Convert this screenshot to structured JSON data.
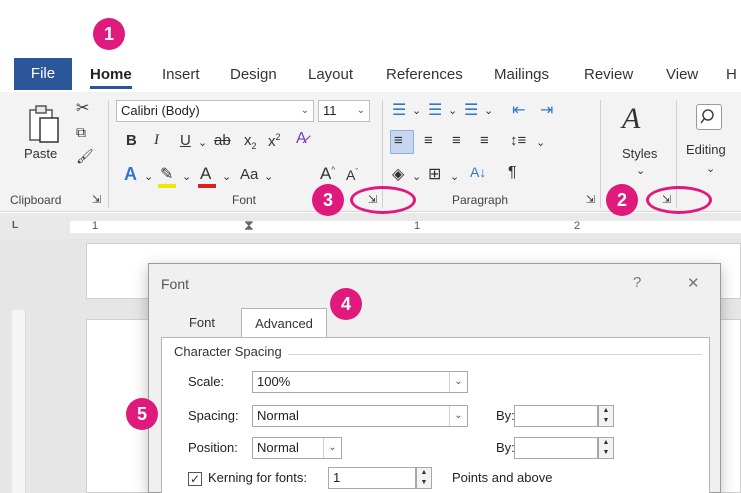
{
  "tabs": [
    "File",
    "Home",
    "Insert",
    "Design",
    "Layout",
    "References",
    "Mailings",
    "Review",
    "View",
    "H"
  ],
  "clipboard": {
    "paste": "Paste",
    "label": "Clipboard"
  },
  "font_group": {
    "font_name": "Calibri (Body)",
    "font_size": "11",
    "bold": "B",
    "italic": "I",
    "underline": "U",
    "strike": "ab",
    "subscript": "x",
    "superscript": "x",
    "change_case": "Aa",
    "grow": "A",
    "shrink": "A",
    "label": "Font"
  },
  "paragraph_group": {
    "label": "Paragraph",
    "sort": "A↓",
    "pilcrow": "¶"
  },
  "styles_group": {
    "label": "Styles"
  },
  "editing_group": {
    "label": "Editing"
  },
  "ruler": {
    "n1": "1",
    "n2": "1",
    "n3": "2",
    "corner": "L"
  },
  "dialog": {
    "title": "Font",
    "help": "?",
    "close": "✕",
    "tabs": [
      "Font",
      "Advanced"
    ],
    "section": "Character Spacing",
    "scale_label": "Scale:",
    "scale_value": "100%",
    "spacing_label": "Spacing:",
    "spacing_value": "Normal",
    "position_label": "Position:",
    "position_value": "Normal",
    "by_label": "By:",
    "kerning_label": "Kerning for fonts:",
    "kerning_value": "1",
    "points_label": "Points and above"
  },
  "annotations": [
    "1",
    "2",
    "3",
    "4",
    "5"
  ],
  "colors": {
    "accent": "#2b579a",
    "highlight": "#e0197d"
  }
}
